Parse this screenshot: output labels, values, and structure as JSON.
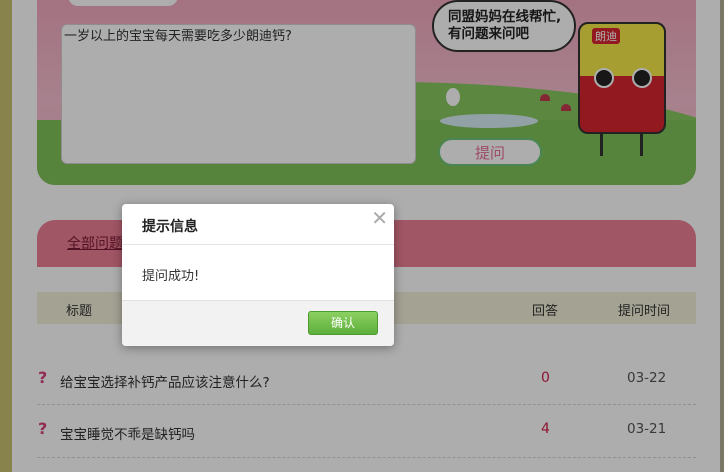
{
  "question_box": {
    "input_value": "一岁以上的宝宝每天需要吃多少朗迪钙?",
    "bubble_text": "同盟妈妈在线帮忙,有问题来问吧",
    "ask_label": "提问",
    "mascot_logo": "朗迪"
  },
  "section": {
    "tab_label": "全部问题"
  },
  "table": {
    "headers": {
      "title": "标题",
      "answers": "回答",
      "time": "提问时间"
    },
    "rows": [
      {
        "title": "给宝宝选择补钙产品应该注意什么?",
        "answers": "0",
        "time": "03-22"
      },
      {
        "title": "宝宝睡觉不乖是缺钙吗",
        "answers": "4",
        "time": "03-21"
      }
    ]
  },
  "dialog": {
    "title": "提示信息",
    "message": "提问成功!",
    "confirm_label": "确认",
    "close_glyph": "✕"
  },
  "colors": {
    "hero_pink": "#f2a9bf",
    "grass": "#86c85f",
    "section_pink": "#ee7f96",
    "accent_red": "#d21e4b",
    "confirm_green": "#5daf3b"
  }
}
